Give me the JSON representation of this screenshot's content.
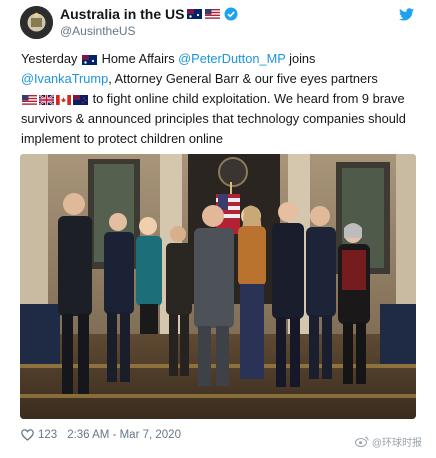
{
  "account": {
    "display_name": "Australia in the US",
    "handle": "@AusintheUS",
    "name_flags": [
      "au-flag-icon",
      "us-flag-icon"
    ],
    "verified_icon": "verified-badge-icon"
  },
  "tweet": {
    "segments": {
      "s1": "Yesterday",
      "s2": "Home Affairs",
      "m1": "@PeterDutton_MP",
      "s3": "joins",
      "m2": "@IvankaTrump",
      "s4": ", Attorney General Barr & our five eyes partners",
      "s5": "to fight online child exploitation. We heard from 9 brave survivors & announced principles that technology companies should implement to protect children online"
    },
    "flags_line3": [
      "us-flag-icon",
      "uk-flag-icon",
      "ca-flag-icon",
      "nz-flag-icon"
    ]
  },
  "photo": {
    "description_icon": "group-photo-image"
  },
  "footer": {
    "like_count": "123",
    "timestamp": "2:36 AM - Mar 7, 2020",
    "watermark": "@环球时报"
  },
  "colors": {
    "link": "#1b95e0",
    "twitter_blue": "#1da1f2",
    "muted": "#657786"
  }
}
